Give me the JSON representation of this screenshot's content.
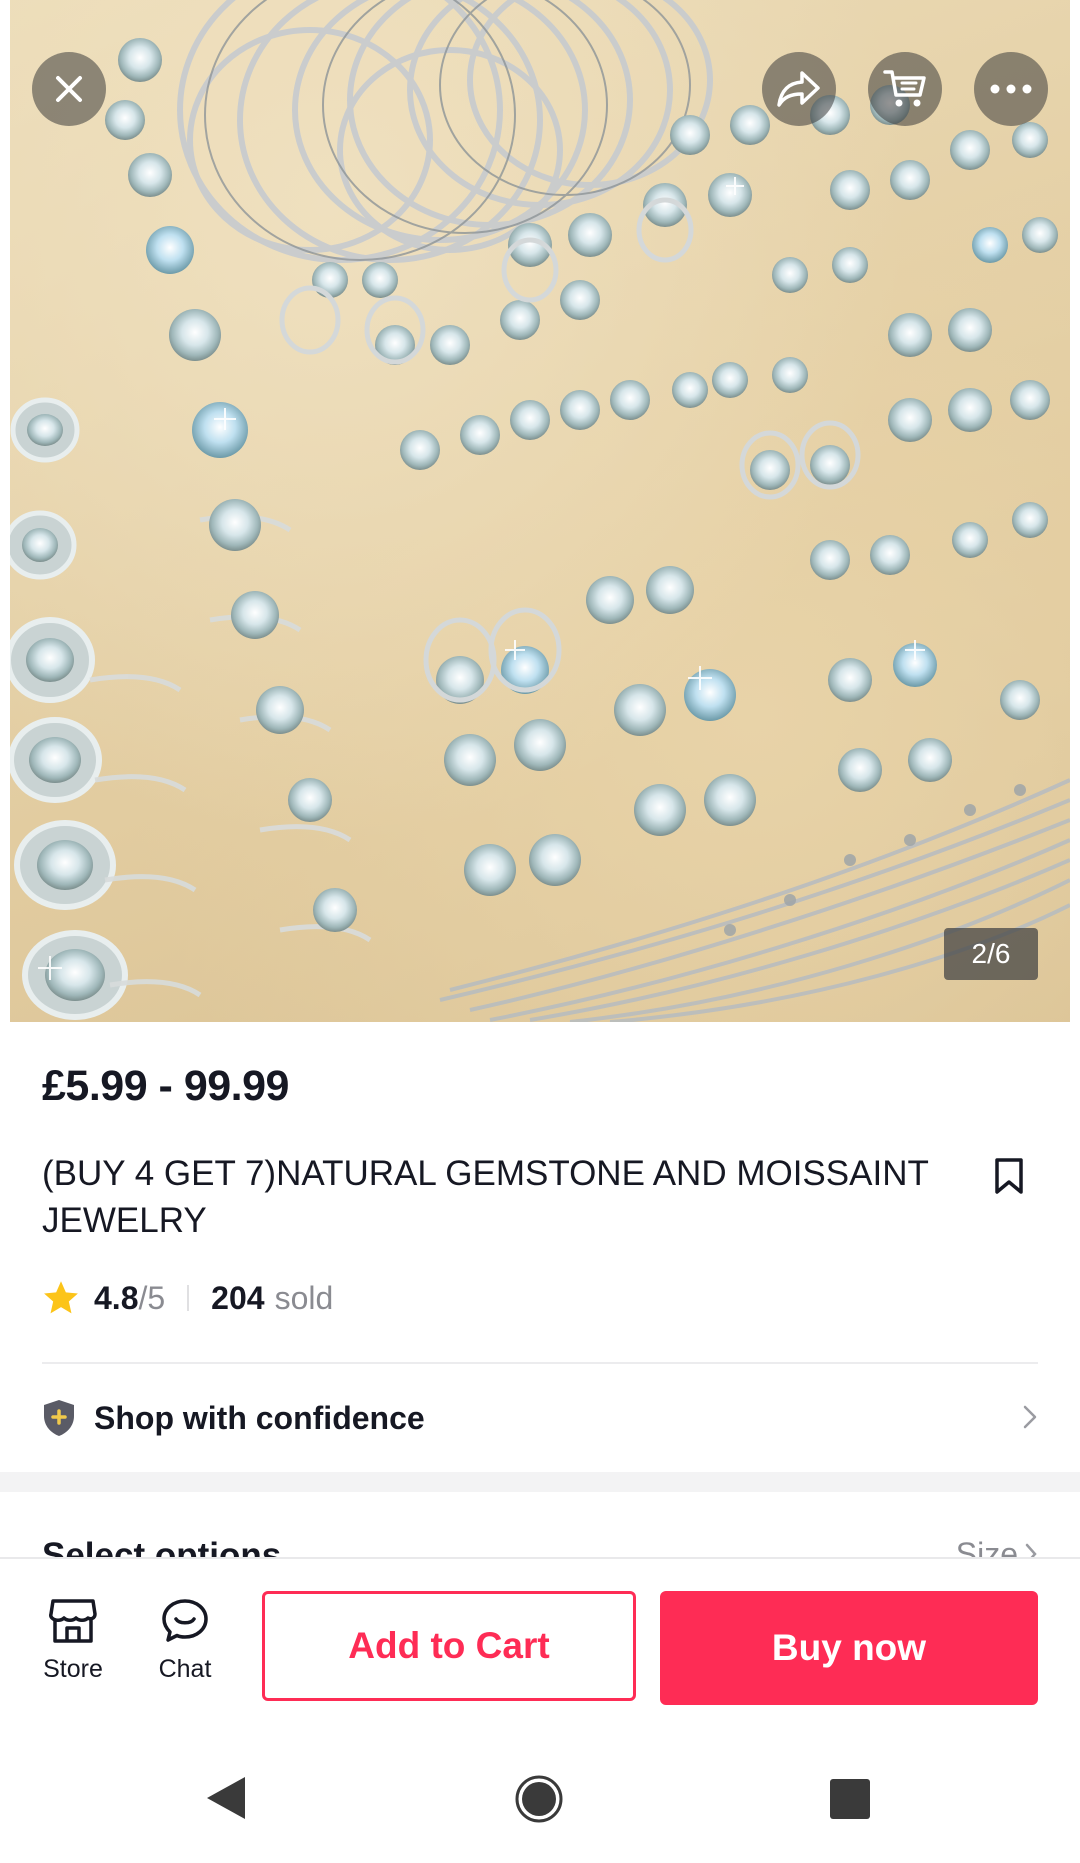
{
  "gallery": {
    "counter": "2/6",
    "image_icons": {
      "close": "close-icon",
      "share": "share-icon",
      "cart": "cart-icon",
      "more": "more-icon"
    }
  },
  "product": {
    "price": "£5.99 - 99.99",
    "title": "(BUY 4 GET 7)NATURAL GEMSTONE AND MOISSAINT JEWELRY",
    "rating_value": "4.8",
    "rating_max": "/5",
    "sold_count": "204",
    "sold_label": "sold"
  },
  "confidence": {
    "label": "Shop with confidence"
  },
  "options": {
    "label": "Select options",
    "size_label": "Size"
  },
  "bottom_bar": {
    "store_label": "Store",
    "chat_label": "Chat",
    "add_to_cart_label": "Add to Cart",
    "buy_now_label": "Buy now"
  },
  "colors": {
    "accent": "#fe2c55",
    "star": "#fcc419",
    "text_primary": "#161823",
    "text_secondary": "#8a8b91"
  }
}
